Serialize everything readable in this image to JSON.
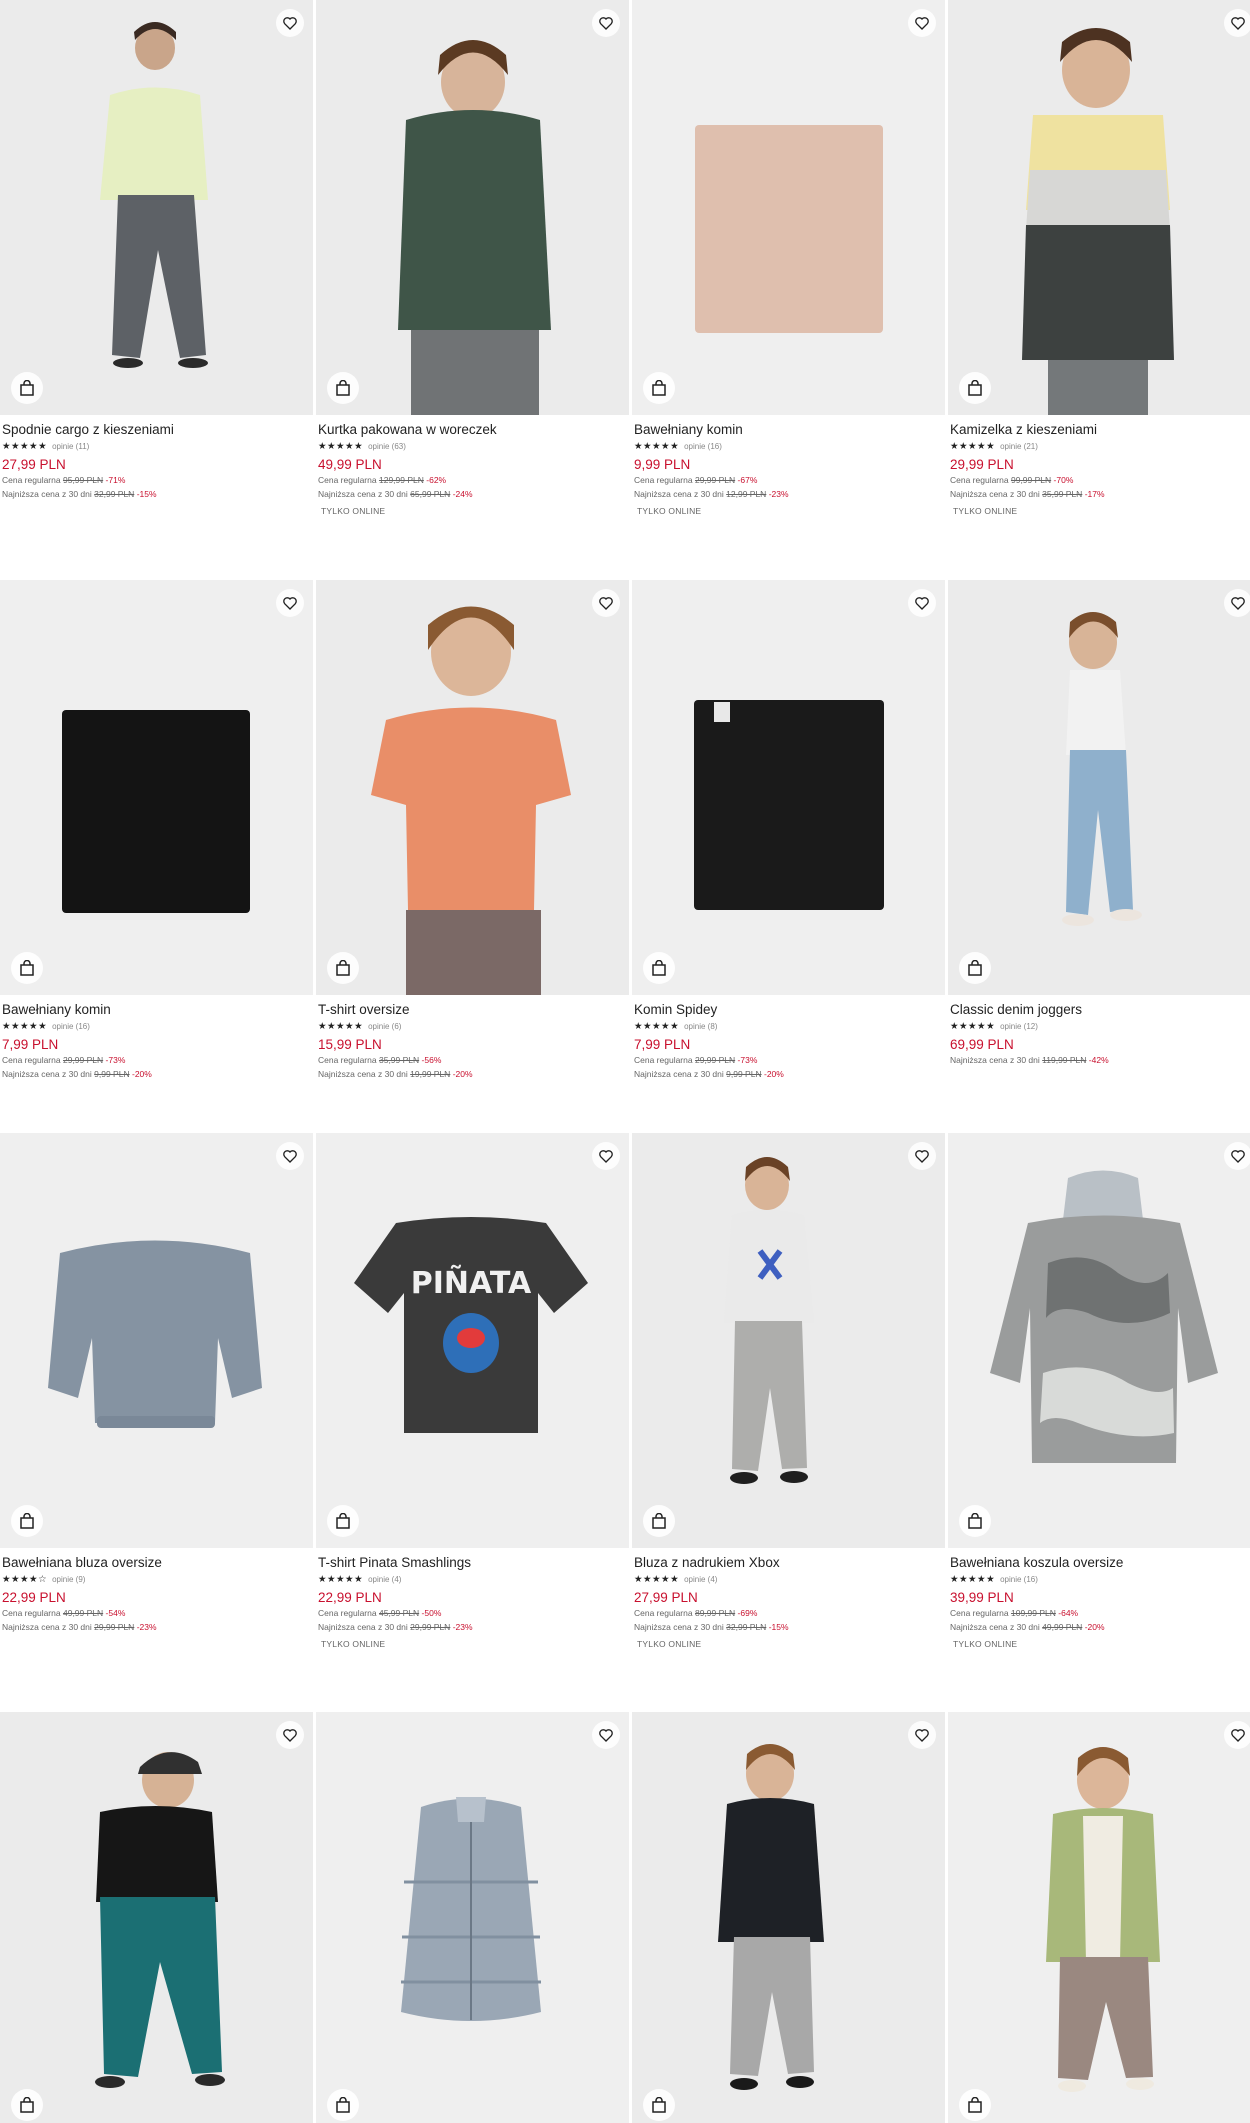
{
  "products": [
    {
      "name": "Spodnie cargo z kieszeniami",
      "stars": "★★★★★",
      "reviews": "opinie (11)",
      "price": "27,99 PLN",
      "regular_label": "Cena regularna",
      "regular_price": "95,99 PLN",
      "regular_disc": "-71%",
      "lowest_label": "Najniższa cena z 30 dni",
      "lowest_price": "32,99 PLN",
      "lowest_disc": "-15%",
      "online": ""
    },
    {
      "name": "Kurtka pakowana w woreczek",
      "stars": "★★★★★",
      "reviews": "opinie (63)",
      "price": "49,99 PLN",
      "regular_label": "Cena regularna",
      "regular_price": "129,99 PLN",
      "regular_disc": "-62%",
      "lowest_label": "Najniższa cena z 30 dni",
      "lowest_price": "65,99 PLN",
      "lowest_disc": "-24%",
      "online": "TYLKO ONLINE"
    },
    {
      "name": "Bawełniany komin",
      "stars": "★★★★★",
      "reviews": "opinie (16)",
      "price": "9,99 PLN",
      "regular_label": "Cena regularna",
      "regular_price": "29,99 PLN",
      "regular_disc": "-67%",
      "lowest_label": "Najniższa cena z 30 dni",
      "lowest_price": "12,99 PLN",
      "lowest_disc": "-23%",
      "online": "TYLKO ONLINE"
    },
    {
      "name": "Kamizelka z kieszeniami",
      "stars": "★★★★★",
      "reviews": "opinie (21)",
      "price": "29,99 PLN",
      "regular_label": "Cena regularna",
      "regular_price": "99,99 PLN",
      "regular_disc": "-70%",
      "lowest_label": "Najniższa cena z 30 dni",
      "lowest_price": "35,99 PLN",
      "lowest_disc": "-17%",
      "online": "TYLKO ONLINE"
    },
    {
      "name": "Bawełniany komin",
      "stars": "★★★★★",
      "reviews": "opinie (16)",
      "price": "7,99 PLN",
      "regular_label": "Cena regularna",
      "regular_price": "29,99 PLN",
      "regular_disc": "-73%",
      "lowest_label": "Najniższa cena z 30 dni",
      "lowest_price": "9,99 PLN",
      "lowest_disc": "-20%",
      "online": ""
    },
    {
      "name": "T-shirt oversize",
      "stars": "★★★★★",
      "reviews": "opinie (6)",
      "price": "15,99 PLN",
      "regular_label": "Cena regularna",
      "regular_price": "35,99 PLN",
      "regular_disc": "-56%",
      "lowest_label": "Najniższa cena z 30 dni",
      "lowest_price": "19,99 PLN",
      "lowest_disc": "-20%",
      "online": ""
    },
    {
      "name": "Komin Spidey",
      "stars": "★★★★★",
      "reviews": "opinie (8)",
      "price": "7,99 PLN",
      "regular_label": "Cena regularna",
      "regular_price": "29,99 PLN",
      "regular_disc": "-73%",
      "lowest_label": "Najniższa cena z 30 dni",
      "lowest_price": "9,99 PLN",
      "lowest_disc": "-20%",
      "online": ""
    },
    {
      "name": "Classic denim joggers",
      "stars": "★★★★★",
      "reviews": "opinie (12)",
      "price": "69,99 PLN",
      "regular_label": "",
      "regular_price": "",
      "regular_disc": "",
      "lowest_label": "Najniższa cena z 30 dni",
      "lowest_price": "119,99 PLN",
      "lowest_disc": "-42%",
      "online": ""
    },
    {
      "name": "Bawełniana bluza oversize",
      "stars": "★★★★☆",
      "reviews": "opinie (9)",
      "price": "22,99 PLN",
      "regular_label": "Cena regularna",
      "regular_price": "49,99 PLN",
      "regular_disc": "-54%",
      "lowest_label": "Najniższa cena z 30 dni",
      "lowest_price": "29,99 PLN",
      "lowest_disc": "-23%",
      "online": ""
    },
    {
      "name": "T-shirt Pinata Smashlings",
      "stars": "★★★★★",
      "reviews": "opinie (4)",
      "price": "22,99 PLN",
      "regular_label": "Cena regularna",
      "regular_price": "45,99 PLN",
      "regular_disc": "-50%",
      "lowest_label": "Najniższa cena z 30 dni",
      "lowest_price": "29,99 PLN",
      "lowest_disc": "-23%",
      "online": "TYLKO ONLINE",
      "print_text": "PIÑATA"
    },
    {
      "name": "Bluza z nadrukiem Xbox",
      "stars": "★★★★★",
      "reviews": "opinie (4)",
      "price": "27,99 PLN",
      "regular_label": "Cena regularna",
      "regular_price": "89,99 PLN",
      "regular_disc": "-69%",
      "lowest_label": "Najniższa cena z 30 dni",
      "lowest_price": "32,99 PLN",
      "lowest_disc": "-15%",
      "online": "TYLKO ONLINE"
    },
    {
      "name": "Bawełniana koszula oversize",
      "stars": "★★★★★",
      "reviews": "opinie (16)",
      "price": "39,99 PLN",
      "regular_label": "Cena regularna",
      "regular_price": "109,99 PLN",
      "regular_disc": "-64%",
      "lowest_label": "Najniższa cena z 30 dni",
      "lowest_price": "49,99 PLN",
      "lowest_disc": "-20%",
      "online": "TYLKO ONLINE"
    },
    {
      "name": "",
      "stars": "",
      "reviews": "",
      "price": "",
      "regular_label": "",
      "regular_price": "",
      "regular_disc": "",
      "lowest_label": "",
      "lowest_price": "",
      "lowest_disc": "",
      "online": ""
    },
    {
      "name": "",
      "stars": "",
      "reviews": "",
      "price": "",
      "regular_label": "",
      "regular_price": "",
      "regular_disc": "",
      "lowest_label": "",
      "lowest_price": "",
      "lowest_disc": "",
      "online": ""
    },
    {
      "name": "",
      "stars": "",
      "reviews": "",
      "price": "",
      "regular_label": "",
      "regular_price": "",
      "regular_disc": "",
      "lowest_label": "",
      "lowest_price": "",
      "lowest_disc": "",
      "online": ""
    },
    {
      "name": "",
      "stars": "",
      "reviews": "",
      "price": "",
      "regular_label": "",
      "regular_price": "",
      "regular_disc": "",
      "lowest_label": "",
      "lowest_price": "",
      "lowest_disc": "",
      "online": ""
    }
  ],
  "icons": {
    "favorite": "heart-icon",
    "cart": "shopping-bag-icon"
  },
  "colors": {
    "sale_red": "#c8102e",
    "text": "#222222",
    "muted": "#666666",
    "image_bg": "#ebebeb"
  }
}
